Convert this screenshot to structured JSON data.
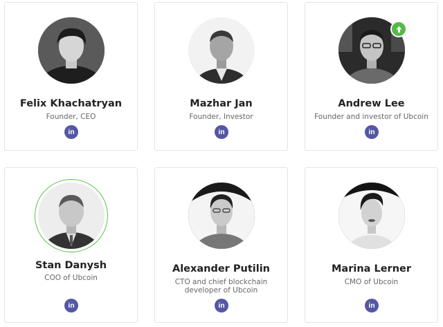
{
  "brand_colors": {
    "linkedin": "#5457a4",
    "accent_green": "#55b94a",
    "name_text": "#222222",
    "role_text": "#666666"
  },
  "team": [
    {
      "name": "Felix Khachatryan",
      "role": "Founder, CEO",
      "social": "LinkedIn"
    },
    {
      "name": "Mazhar Jan",
      "role": "Founder, Investor",
      "social": "LinkedIn"
    },
    {
      "name": "Andrew Lee",
      "role": "Founder and investor of Ubcoin",
      "social": "LinkedIn",
      "badge_icon": "arrow-up-icon"
    },
    {
      "name": "Stan Danysh",
      "role": "COO of Ubcoin",
      "social": "LinkedIn",
      "highlighted": true
    },
    {
      "name": "Alexander Putilin",
      "role": "CTO and chief blockchain developer of Ubcoin",
      "social": "LinkedIn"
    },
    {
      "name": "Marina Lerner",
      "role": "CMO of Ubcoin",
      "social": "LinkedIn"
    }
  ],
  "icons": {
    "linkedin_glyph": "in"
  }
}
